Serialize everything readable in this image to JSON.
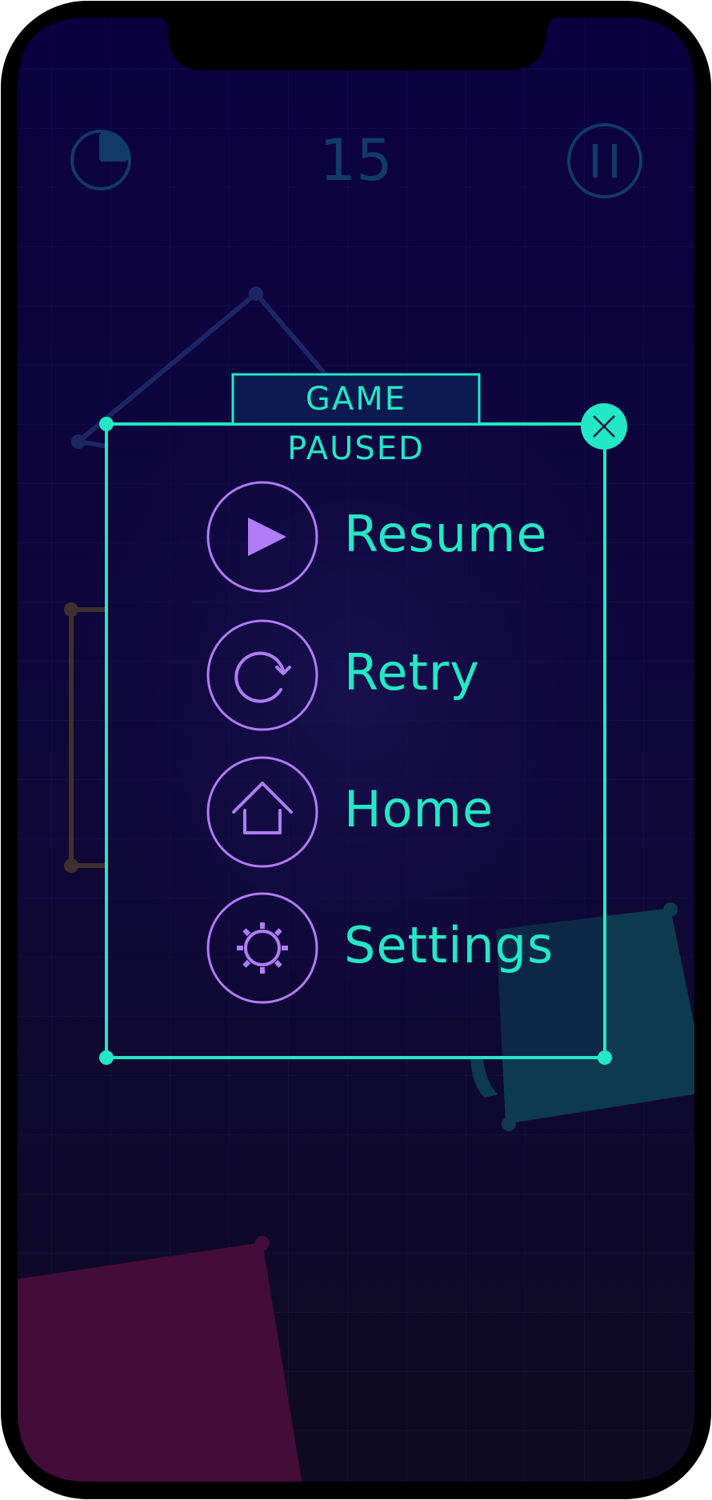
{
  "hud": {
    "score": "15",
    "timer_icon": "clock-pie-icon",
    "pause_icon": "pause-icon",
    "timer_elapsed_fraction": 0.25
  },
  "pause_menu": {
    "title": "GAME PAUSED",
    "close_icon": "close-icon",
    "items": [
      {
        "label": "Resume",
        "icon": "play-icon"
      },
      {
        "label": "Retry",
        "icon": "retry-icon"
      },
      {
        "label": "Home",
        "icon": "home-icon"
      },
      {
        "label": "Settings",
        "icon": "gear-icon"
      }
    ]
  },
  "colors": {
    "accent": "#22e8c6",
    "icon_purple": "#b07cf7",
    "hud": "#123a68",
    "background_top": "#0a0040",
    "background_bottom": "#0e0a20",
    "teal_block": "#0d3a4e",
    "magenta_block": "#430c39"
  }
}
